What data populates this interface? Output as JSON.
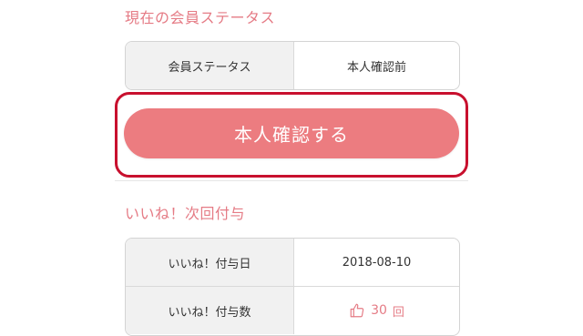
{
  "status_section": {
    "title": "現在の会員ステータス",
    "rows": [
      {
        "label": "会員ステータス",
        "value": "本人確認前"
      }
    ]
  },
  "verify_button": {
    "label": "本人確認する"
  },
  "likes_section": {
    "title": "いいね！次回付与",
    "rows": [
      {
        "label": "いいね！付与日",
        "value": "2018-08-10"
      },
      {
        "label": "いいね！付与数",
        "count": "30",
        "unit": "回",
        "icon": "thumbs-up-icon"
      }
    ]
  },
  "colors": {
    "accent": "#ec7c80",
    "section_title": "#e57b85",
    "highlight_frame": "#c8102e"
  }
}
